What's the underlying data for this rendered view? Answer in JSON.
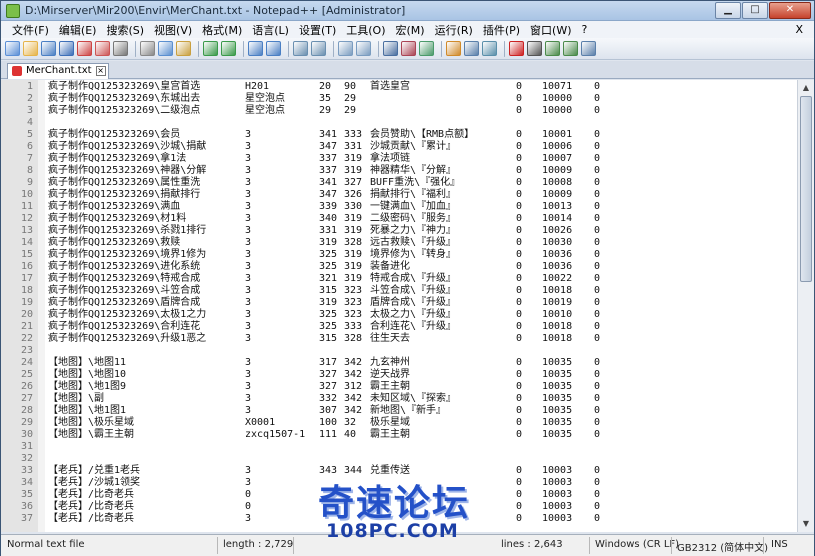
{
  "window": {
    "title": "D:\\Mirserver\\Mir200\\Envir\\MerChant.txt - Notepad++ [Administrator]",
    "controls": [
      "▁",
      "□",
      "✕"
    ]
  },
  "menu": {
    "items": [
      "文件(F)",
      "编辑(E)",
      "搜索(S)",
      "视图(V)",
      "格式(M)",
      "语言(L)",
      "设置(T)",
      "工具(O)",
      "宏(M)",
      "运行(R)",
      "插件(P)",
      "窗口(W)",
      "?"
    ],
    "close": "X"
  },
  "toolbar": {
    "icons": [
      "new-icon",
      "open-icon",
      "save-icon",
      "save-all-icon",
      "close-icon",
      "close-all-icon",
      "print-icon",
      "sep",
      "cut-icon",
      "copy-icon",
      "paste-icon",
      "sep",
      "undo-icon",
      "redo-icon",
      "sep",
      "find-icon",
      "replace-icon",
      "sep",
      "zoom-in-icon",
      "zoom-out-icon",
      "sep",
      "sync-v-icon",
      "sync-h-icon",
      "sep",
      "wrap-icon",
      "all-chars-icon",
      "indent-guide-icon",
      "sep",
      "udl-icon",
      "doc-map-icon",
      "function-list-icon",
      "sep",
      "record-icon",
      "stop-icon",
      "play-icon",
      "play-multi-icon",
      "save-macro-icon"
    ]
  },
  "tab": {
    "label": "MerChant.txt"
  },
  "editor": {
    "lines": [
      {
        "n": "1",
        "c": [
          "疯子制作QQ125323269\\皇宫首选",
          "H201",
          "20",
          "90",
          "首选皇宫",
          "0",
          "10071",
          "0"
        ]
      },
      {
        "n": "2",
        "c": [
          "疯子制作QQ125323269\\东城出去",
          "星空泡点",
          "35",
          "29",
          "",
          "0",
          "10000",
          "0"
        ]
      },
      {
        "n": "3",
        "c": [
          "疯子制作QQ125323269\\二级泡点",
          "星空泡点",
          "29",
          "29",
          "",
          "0",
          "10000",
          "0"
        ]
      },
      {
        "n": "4",
        "c": [
          "",
          "",
          "",
          "",
          "",
          "",
          "",
          ""
        ]
      },
      {
        "n": "5",
        "c": [
          "疯子制作QQ125323269\\会员",
          "3",
          "341",
          "333",
          "会员赞助\\【RMB点额】",
          "0",
          "10001",
          "0"
        ]
      },
      {
        "n": "6",
        "c": [
          "疯子制作QQ125323269\\沙城\\捐献",
          "3",
          "347",
          "331",
          "沙城贡献\\『累计』",
          "0",
          "10006",
          "0"
        ]
      },
      {
        "n": "7",
        "c": [
          "疯子制作QQ125323269\\拿1法",
          "3",
          "337",
          "319",
          "拿法项链",
          "0",
          "10007",
          "0"
        ]
      },
      {
        "n": "8",
        "c": [
          "疯子制作QQ125323269\\神器\\分解",
          "3",
          "337",
          "319",
          "神器精华\\『分解』",
          "0",
          "10009",
          "0"
        ]
      },
      {
        "n": "9",
        "c": [
          "疯子制作QQ125323269\\属性重洗",
          "3",
          "341",
          "327",
          "BUFF重洗\\『强化』",
          "0",
          "10008",
          "0"
        ]
      },
      {
        "n": "10",
        "c": [
          "疯子制作QQ125323269\\捐献排行",
          "3",
          "347",
          "326",
          "捐献排行\\『福利』",
          "0",
          "10009",
          "0"
        ]
      },
      {
        "n": "11",
        "c": [
          "疯子制作QQ125323269\\满血",
          "3",
          "339",
          "330",
          "一键满血\\『加血』",
          "0",
          "10013",
          "0"
        ]
      },
      {
        "n": "12",
        "c": [
          "疯子制作QQ125323269\\材1料",
          "3",
          "340",
          "319",
          "二级密码\\『服务』",
          "0",
          "10014",
          "0"
        ]
      },
      {
        "n": "13",
        "c": [
          "疯子制作QQ125323269\\杀戮1排行",
          "3",
          "331",
          "319",
          "死暴之力\\『神力』",
          "0",
          "10026",
          "0"
        ]
      },
      {
        "n": "14",
        "c": [
          "疯子制作QQ125323269\\救赎",
          "3",
          "319",
          "328",
          "远古救赎\\『升级』",
          "0",
          "10030",
          "0"
        ]
      },
      {
        "n": "15",
        "c": [
          "疯子制作QQ125323269\\境界1修为",
          "3",
          "325",
          "319",
          "境界修为\\『转身』",
          "0",
          "10036",
          "0"
        ]
      },
      {
        "n": "16",
        "c": [
          "疯子制作QQ125323269\\进化系统",
          "3",
          "325",
          "319",
          "装备进化",
          "0",
          "10036",
          "0"
        ]
      },
      {
        "n": "17",
        "c": [
          "疯子制作QQ125323269\\特戒合成",
          "3",
          "321",
          "319",
          "特戒合成\\『升级』",
          "0",
          "10022",
          "0"
        ]
      },
      {
        "n": "18",
        "c": [
          "疯子制作QQ125323269\\斗笠合成",
          "3",
          "315",
          "323",
          "斗笠合成\\『升级』",
          "0",
          "10018",
          "0"
        ]
      },
      {
        "n": "19",
        "c": [
          "疯子制作QQ125323269\\盾牌合成",
          "3",
          "319",
          "323",
          "盾牌合成\\『升级』",
          "0",
          "10019",
          "0"
        ]
      },
      {
        "n": "20",
        "c": [
          "疯子制作QQ125323269\\太极1之力",
          "3",
          "325",
          "323",
          "太极之力\\『升级』",
          "0",
          "10010",
          "0"
        ]
      },
      {
        "n": "21",
        "c": [
          "疯子制作QQ125323269\\合利连花",
          "3",
          "325",
          "333",
          "合利连花\\『升级』",
          "0",
          "10018",
          "0"
        ]
      },
      {
        "n": "22",
        "c": [
          "疯子制作QQ125323269\\升级1恶之",
          "3",
          "315",
          "328",
          "往生天去",
          "0",
          "10018",
          "0"
        ]
      },
      {
        "n": "23",
        "c": [
          "",
          "",
          "",
          "",
          "",
          "",
          "",
          ""
        ]
      },
      {
        "n": "24",
        "c": [
          "【地图】\\地图11",
          "3",
          "317",
          "342",
          "九玄神州",
          "0",
          "10035",
          "0"
        ]
      },
      {
        "n": "25",
        "c": [
          "【地图】\\地图10",
          "3",
          "327",
          "342",
          "逆天战界",
          "0",
          "10035",
          "0"
        ]
      },
      {
        "n": "26",
        "c": [
          "【地图】\\地1图9",
          "3",
          "327",
          "312",
          "霸王主朝",
          "0",
          "10035",
          "0"
        ]
      },
      {
        "n": "27",
        "c": [
          "【地图】\\副",
          "3",
          "332",
          "342",
          "未知区域\\『探索』",
          "0",
          "10035",
          "0"
        ]
      },
      {
        "n": "28",
        "c": [
          "【地图】\\地1图1",
          "3",
          "307",
          "342",
          "新地图\\『新手』",
          "0",
          "10035",
          "0"
        ]
      },
      {
        "n": "29",
        "c": [
          "【地图】\\极乐星域",
          "X0001",
          "100",
          "32",
          "极乐星域",
          "0",
          "10035",
          "0"
        ]
      },
      {
        "n": "30",
        "c": [
          "【地图】\\霸王主朝",
          "zxcq1507-1",
          "111",
          "40",
          "霸王主朝",
          "0",
          "10035",
          "0"
        ]
      },
      {
        "n": "31",
        "c": [
          "",
          "",
          "",
          "",
          "",
          "",
          "",
          ""
        ]
      },
      {
        "n": "32",
        "c": [
          "",
          "",
          "",
          "",
          "",
          "",
          "",
          ""
        ]
      },
      {
        "n": "33",
        "c": [
          "【老兵】/兑重1老兵",
          "3",
          "343",
          "344",
          "兑重传送",
          "0",
          "10003",
          "0"
        ]
      },
      {
        "n": "34",
        "c": [
          "【老兵】/沙城1领奖",
          "3",
          "",
          "",
          "",
          "0",
          "10003",
          "0"
        ]
      },
      {
        "n": "35",
        "c": [
          "【老兵】/比奇老兵",
          "0",
          "",
          "",
          "",
          "0",
          "10003",
          "0"
        ]
      },
      {
        "n": "36",
        "c": [
          "【老兵】/比奇老兵",
          "0",
          "",
          "",
          "",
          "0",
          "10003",
          "0"
        ]
      },
      {
        "n": "37",
        "c": [
          "【老兵】/比奇老兵",
          "3",
          "",
          "",
          "",
          "0",
          "10003",
          "0"
        ]
      }
    ]
  },
  "status": {
    "type": "Normal text file",
    "length": "length : 2,729",
    "lines": "lines : 2,643",
    "eol": "Windows (CR LF)",
    "encoding": "GB2312 (简体中文)",
    "mode": "INS"
  },
  "watermark": {
    "big": "奇速论坛",
    "small": "108PC.COM"
  }
}
